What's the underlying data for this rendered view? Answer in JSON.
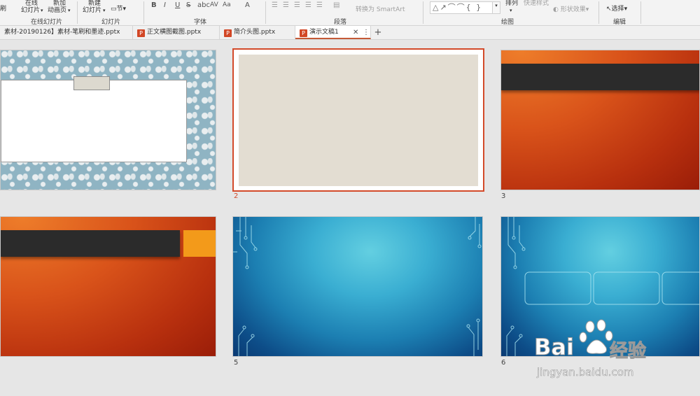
{
  "ribbon": {
    "row1": {
      "brush_partial": "刷",
      "online_top": "在线",
      "online_bottom": "幻灯片",
      "new_anim_top": "新加",
      "new_anim_bottom": "动画页",
      "new_slide_top": "新建",
      "new_slide_bottom": "幻灯片",
      "section": "节",
      "arrange": "排列",
      "quick_style": "快速样式",
      "shape_effect": "形状效果",
      "select": "选择",
      "convert_smartart": "转换为 SmartArt",
      "font_case": "Aa",
      "font_color": "A",
      "bold": "B",
      "italic": "I",
      "underline": "U",
      "strike": "S",
      "spacing": "AV"
    },
    "groups": {
      "online_slides": "在线幻灯片",
      "slides": "幻灯片",
      "font": "字体",
      "paragraph": "段落",
      "drawing": "绘图",
      "editing": "编辑"
    }
  },
  "tabs": [
    {
      "label": "素材-20190126】素材-笔刷和墨迹.pptx",
      "active": false
    },
    {
      "label": "正文横图截图.pptx",
      "active": false
    },
    {
      "label": "简介头图.pptx",
      "active": false
    },
    {
      "label": "演示文稿1",
      "active": true
    }
  ],
  "slides": [
    {
      "number": "",
      "selected": false
    },
    {
      "number": "2",
      "selected": true
    },
    {
      "number": "3",
      "selected": false
    },
    {
      "number": "",
      "selected": false
    },
    {
      "number": "5",
      "selected": false
    },
    {
      "number": "6",
      "selected": false
    }
  ],
  "colors": {
    "selection_border": "#d34a2a",
    "selected_number": "#d34a2a",
    "active_tab_accent": "#c55a37"
  },
  "watermark": {
    "brand": "Bai",
    "brand2": "经验",
    "url": "jingyan.baidu.com"
  }
}
